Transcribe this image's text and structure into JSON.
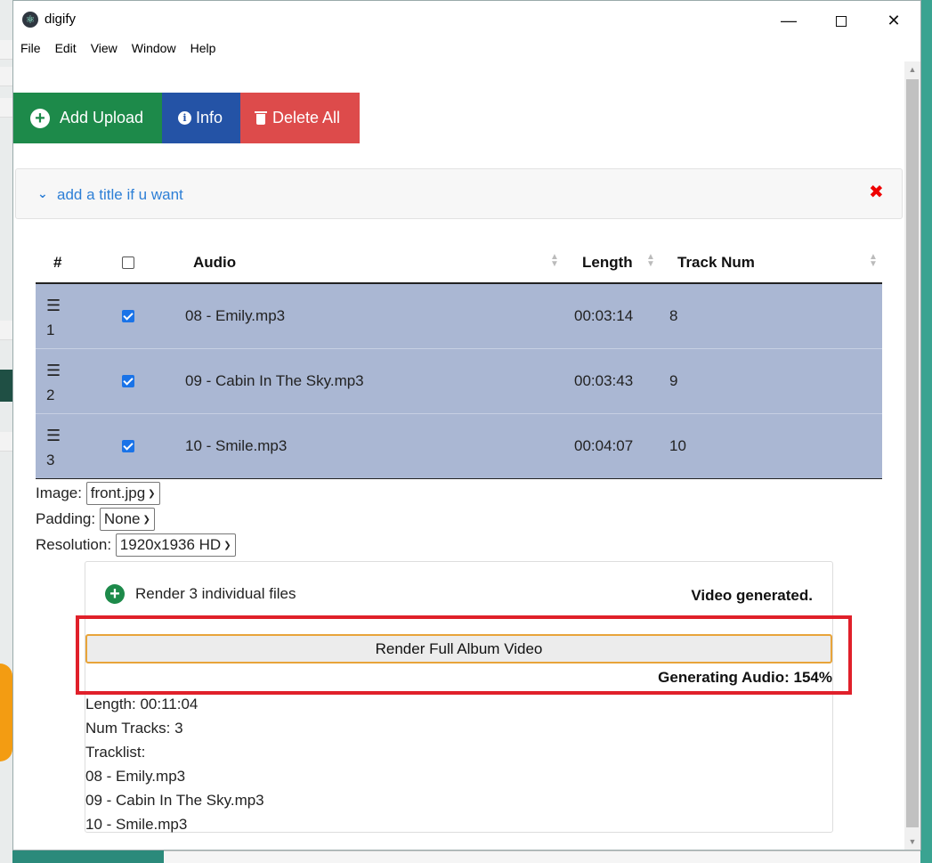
{
  "app": {
    "title": "digify",
    "icon": "atom-icon"
  },
  "window_controls": {
    "minimize": "—",
    "close": "✕"
  },
  "menu": [
    "File",
    "Edit",
    "View",
    "Window",
    "Help"
  ],
  "toolbar": {
    "add_upload": "Add Upload",
    "info": "Info",
    "delete_all": "Delete All",
    "colors": {
      "add": "#1d8a4a",
      "info": "#2453a6",
      "delete": "#dd4b4b"
    }
  },
  "title_panel": {
    "link_text": "add a title if u want",
    "close_symbol": "✖"
  },
  "table": {
    "headers": [
      "#",
      "Audio",
      "Length",
      "Track Num"
    ],
    "rows": [
      {
        "num": "1",
        "checked": true,
        "audio": "08 - Emily.mp3",
        "length": "00:03:14",
        "track": "8"
      },
      {
        "num": "2",
        "checked": true,
        "audio": "09 - Cabin In The Sky.mp3",
        "length": "00:03:43",
        "track": "9"
      },
      {
        "num": "3",
        "checked": true,
        "audio": "10 - Smile.mp3",
        "length": "00:04:07",
        "track": "10"
      }
    ],
    "row_color": "#aab7d3"
  },
  "form": {
    "image_label": "Image:",
    "image_value": "front.jpg",
    "padding_label": "Padding:",
    "padding_value": "None",
    "resolution_label": "Resolution:",
    "resolution_value": "1920x1936 HD"
  },
  "render": {
    "individual_label": "Render 3 individual files",
    "status": "Video generated.",
    "full_album_button": "Render Full Album Video",
    "progress_text": "Generating Audio: 154%",
    "length": "Length: 00:11:04",
    "num_tracks": "Num Tracks: 3",
    "tracklist_label": "Tracklist:",
    "tracklist": [
      "08 - Emily.mp3",
      "09 - Cabin In The Sky.mp3",
      "10 - Smile.mp3"
    ]
  },
  "highlight_color": "#e0202a"
}
